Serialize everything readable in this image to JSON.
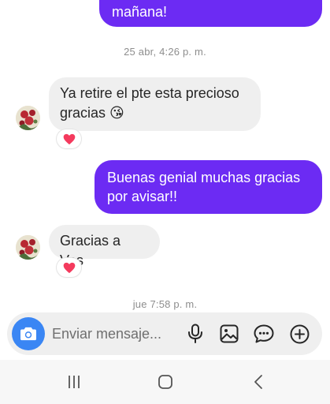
{
  "messages": [
    {
      "id": "m0",
      "direction": "outgoing",
      "text": "mañana!"
    },
    {
      "id": "m1",
      "direction": "incoming",
      "lines": [
        "Ya retire el pte esta precioso",
        "gracias 😘"
      ],
      "reaction": "heart"
    },
    {
      "id": "m2",
      "direction": "outgoing",
      "lines": [
        "Buenas genial muchas gracias",
        "por avisar!!"
      ]
    },
    {
      "id": "m3",
      "direction": "incoming",
      "text": "Gracias a Vos",
      "reaction": "heart"
    }
  ],
  "timestamps": {
    "t1": "25 abr, 4:26 p. m.",
    "t2": "jue 7:58 p. m."
  },
  "composer": {
    "placeholder": "Enviar mensaje...",
    "icons": [
      "camera-icon",
      "microphone-icon",
      "gallery-icon",
      "sticker-icon",
      "add-icon"
    ]
  },
  "navigation": {
    "icons": [
      "recent-apps-icon",
      "home-icon",
      "back-icon"
    ]
  },
  "colors": {
    "outgoing_bubble": "#6c2bf3",
    "incoming_bubble": "#efefef",
    "camera_button": "#3a86f4",
    "reaction_heart": "#f43a5d"
  }
}
